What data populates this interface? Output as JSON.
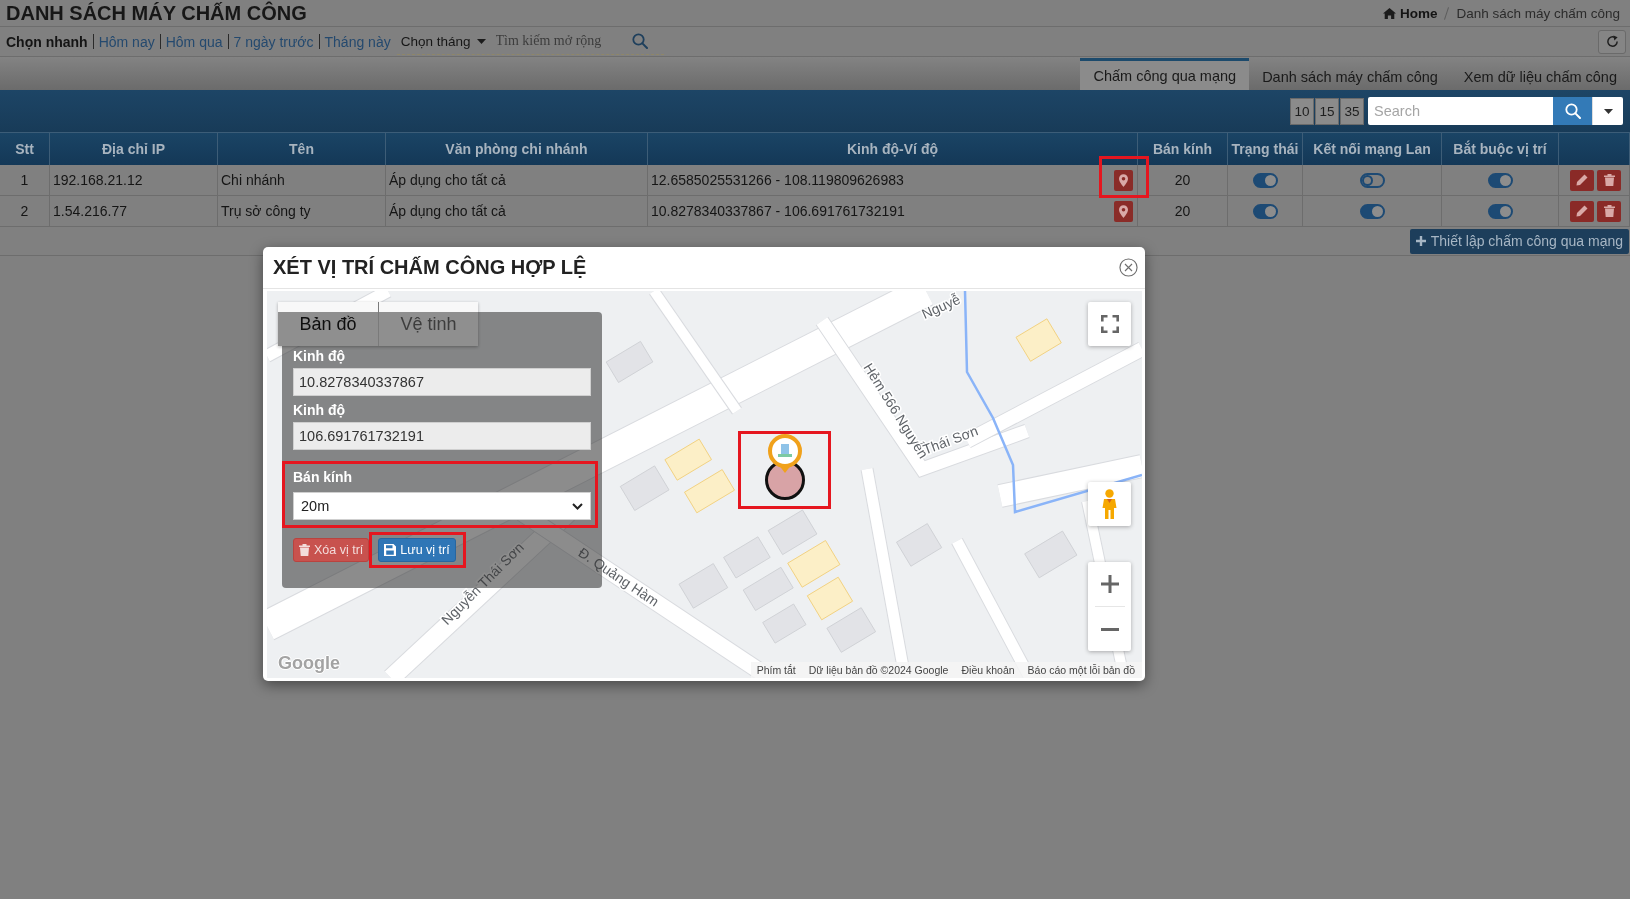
{
  "page": {
    "title": "DANH SÁCH MÁY CHẤM CÔNG",
    "breadcrumb": [
      {
        "label": "Home",
        "kind": "home"
      },
      {
        "label": "Danh sách máy chấm công",
        "kind": "current"
      }
    ]
  },
  "filter_bar": {
    "quick_label": "Chọn nhanh",
    "quick_links": [
      "Hôm nay",
      "Hôm qua",
      "7 ngày trước",
      "Tháng này"
    ],
    "month_dropdown": "Chọn tháng",
    "search": {
      "placeholder": "Tìm kiếm mở rộng"
    }
  },
  "tabs": [
    {
      "label": "Chấm công qua mạng",
      "selected": true
    },
    {
      "label": "Danh sách máy chấm công",
      "selected": false
    },
    {
      "label": "Xem dữ liệu chấm công",
      "selected": false
    }
  ],
  "toolbar": {
    "page_sizes": [
      "10",
      "15",
      "35"
    ],
    "search": {
      "placeholder": "Search"
    }
  },
  "table": {
    "columns": [
      "Stt",
      "Địa chỉ IP",
      "Tên",
      "Văn phòng chi nhánh",
      "Kinh độ-Ví độ",
      "Bán kính",
      "Trạng thái",
      "Kết nối mạng Lan",
      "Bắt buộc vị trí"
    ],
    "rows": [
      {
        "stt": "1",
        "ip": "192.168.21.12",
        "name": "Chi nhánh",
        "office": "Áp dụng cho tất cả",
        "coordinates": "12.6585025531266 - 108.119809626983",
        "location_highlighted": true,
        "radius": "20",
        "status_on": true,
        "lan_connected": false,
        "location_required": true
      },
      {
        "stt": "2",
        "ip": "1.54.216.77",
        "name": "Trụ sở công ty",
        "office": "Áp dụng cho tất cả",
        "coordinates": "10.8278340337867 - 106.691761732191",
        "location_highlighted": false,
        "radius": "20",
        "status_on": true,
        "lan_connected": true,
        "location_required": true
      }
    ]
  },
  "add_button": "Thiết lập chấm công qua mạng",
  "modal": {
    "title": "XÉT VỊ TRÍ CHẤM CÔNG HỢP LỆ",
    "map": {
      "map_types": [
        {
          "label": "Bản đồ",
          "selected": true
        },
        {
          "label": "Vệ tinh",
          "selected": false
        }
      ],
      "street_labels": [
        "Nguyễn Thái Sơn",
        "Đ. Quảng Hàm",
        "Hẻm 566 Nguyễn Thái Sơn",
        "Nguyễ"
      ],
      "marker_highlighted": true,
      "logo": "Google",
      "footer": [
        "Phím tắt",
        "Dữ liệu bản đồ ©2024 Google",
        "Điều khoản",
        "Báo cáo một lỗi bản đồ"
      ]
    },
    "form": {
      "fields": [
        {
          "label": "Kinh độ",
          "value": "10.8278340337867",
          "kind": "readonly",
          "highlighted": false
        },
        {
          "label": "Kinh độ",
          "value": "106.691761732191",
          "kind": "readonly",
          "highlighted": false
        },
        {
          "label": "Bán kính",
          "value": "20m",
          "kind": "select",
          "highlighted": true
        }
      ],
      "buttons": [
        {
          "label": "Xóa vị trí",
          "kind": "delete",
          "highlighted": false
        },
        {
          "label": "Lưu vị trí",
          "kind": "save",
          "highlighted": true
        }
      ]
    }
  }
}
